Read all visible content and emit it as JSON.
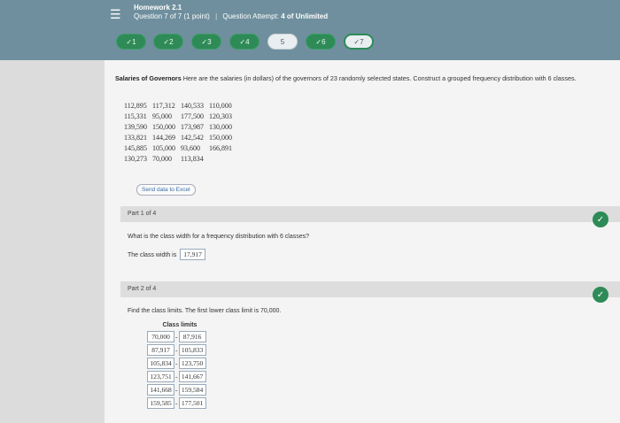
{
  "header": {
    "title": "Homework 2.1",
    "question_info": "Question 7 of 7 (1 point)",
    "attempt_label": "Question Attempt:",
    "attempt_value": "4 of Unlimited"
  },
  "question_nav": [
    {
      "label": "✓1",
      "state": "done"
    },
    {
      "label": "✓2",
      "state": "done"
    },
    {
      "label": "✓3",
      "state": "done"
    },
    {
      "label": "✓4",
      "state": "done"
    },
    {
      "label": "5",
      "state": "todo"
    },
    {
      "label": "✓6",
      "state": "done"
    },
    {
      "label": "✓7",
      "state": "current"
    }
  ],
  "problem": {
    "title": "Salaries of Governors",
    "text": "Here are the salaries (in dollars) of the governors of 23 randomly selected states. Construct a grouped frequency distribution with 6 classes.",
    "data_rows": [
      [
        "112,895",
        "117,312",
        "140,533",
        "110,000"
      ],
      [
        "115,331",
        "95,000",
        "177,500",
        "120,303"
      ],
      [
        "139,590",
        "150,000",
        "173,987",
        "130,000"
      ],
      [
        "133,821",
        "144,269",
        "142,542",
        "150,000"
      ],
      [
        "145,885",
        "105,000",
        "93,600",
        "166,891"
      ],
      [
        "130,273",
        "70,000",
        "113,834",
        ""
      ]
    ],
    "excel_button": "Send data to Excel"
  },
  "part1": {
    "label": "Part 1 of 4",
    "question": "What is the class width for a frequency distribution with 6 classes?",
    "answer_label": "The class width is",
    "answer_value": "17,917"
  },
  "part2": {
    "label": "Part 2 of 4",
    "question": "Find the class limits. The first lower class limit is 70,000.",
    "table_header": "Class limits",
    "rows": [
      [
        "70,000",
        "87,916"
      ],
      [
        "87,917",
        "105,833"
      ],
      [
        "105,834",
        "123,750"
      ],
      [
        "123,751",
        "141,667"
      ],
      [
        "141,668",
        "159,584"
      ],
      [
        "159,585",
        "177,501"
      ]
    ]
  }
}
